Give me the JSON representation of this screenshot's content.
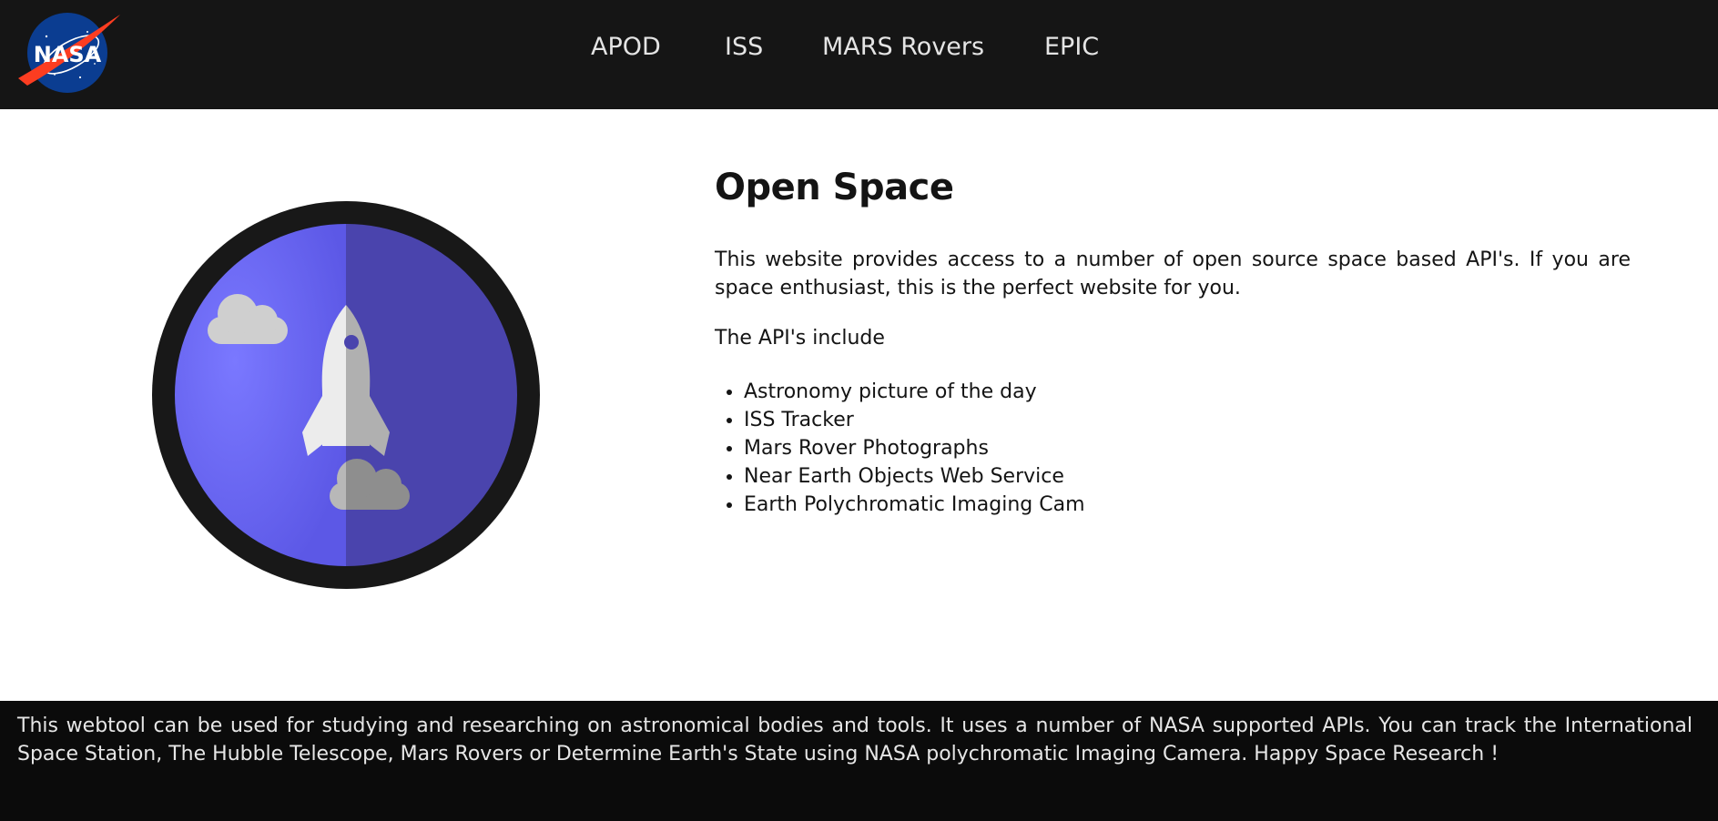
{
  "header": {
    "logo_text": "NASA",
    "nav": [
      {
        "label": "APOD"
      },
      {
        "label": "ISS"
      },
      {
        "label": "MARS Rovers"
      },
      {
        "label": "EPIC"
      }
    ]
  },
  "main": {
    "title": "Open Space",
    "description": "This website provides access to a number of open source space based API's. If you are space enthusiast, this is the perfect website for you.",
    "list_intro": "The API's include",
    "apis": [
      "Astronomy picture of the day",
      "ISS Tracker",
      "Mars Rover Photographs",
      "Near Earth Objects Web Service",
      "Earth Polychromatic Imaging Cam"
    ],
    "illustration": "rocket-icon"
  },
  "footer": {
    "text": "This webtool can be used for studying and researching on astronomical bodies and tools. It uses a number of NASA supported APIs. You can track the International Space Station, The Hubble Telescope, Mars Rovers or Determine Earth's State using NASA polychromatic Imaging Camera. Happy Space Research !"
  },
  "colors": {
    "header_bg": "#151515",
    "footer_bg": "#0b0b0b",
    "hero_purple": "#6a66f0",
    "hero_dark_purple": "#4840a8",
    "nasa_blue": "#0b3d91",
    "nasa_red": "#fc3d21"
  }
}
